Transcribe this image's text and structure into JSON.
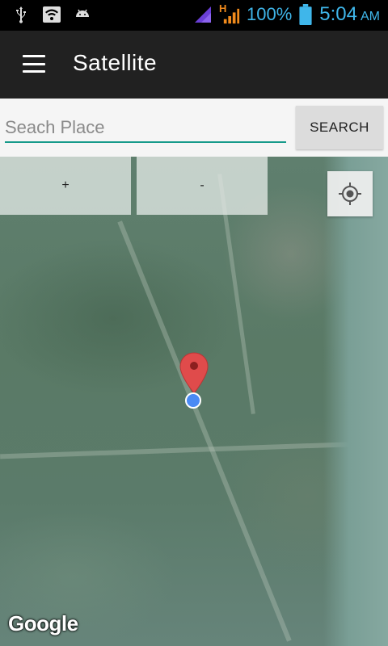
{
  "status_bar": {
    "battery_percent": "100%",
    "time": "5:04",
    "ampm": "AM",
    "network_type": "H",
    "icons": [
      "usb-icon",
      "wifi-icon",
      "android-icon",
      "signal-icon",
      "signal-h-icon",
      "battery-icon"
    ],
    "accent_color": "#3fb6ea"
  },
  "app_bar": {
    "title": "Satellite",
    "menu_icon": "hamburger-menu-icon"
  },
  "search": {
    "placeholder": "Seach Place",
    "value": "",
    "button_label": "SEARCH",
    "underline_color": "#169a8a"
  },
  "map": {
    "zoom_in_label": "+",
    "zoom_out_label": "-",
    "locate_icon": "my-location-icon",
    "marker_icon": "map-marker-icon",
    "location_dot_icon": "current-location-dot-icon",
    "attribution": "Google",
    "marker_color": "#e04b4b",
    "location_dot_color": "#4a8af4"
  }
}
